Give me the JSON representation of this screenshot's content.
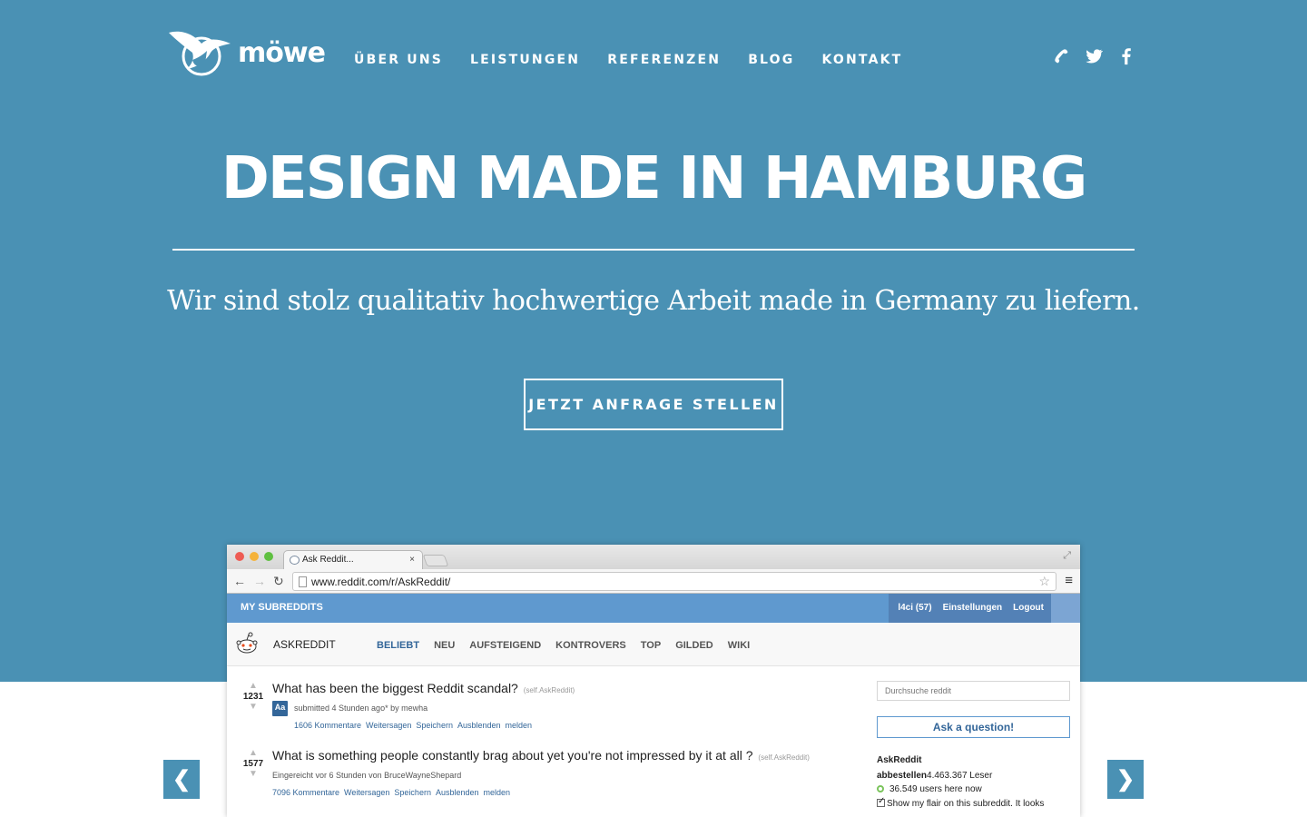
{
  "brand": {
    "name": "möwe",
    "logo_icon": "seagull-logo-icon"
  },
  "nav": {
    "items": [
      {
        "label": "ÜBER UNS"
      },
      {
        "label": "LEISTUNGEN"
      },
      {
        "label": "REFERENZEN"
      },
      {
        "label": "BLOG"
      },
      {
        "label": "KONTAKT"
      }
    ]
  },
  "social": {
    "icons": [
      "phone-icon",
      "twitter-icon",
      "facebook-icon"
    ]
  },
  "hero": {
    "headline": "DESIGN MADE IN HAMBURG",
    "subline": "Wir sind stolz qualitativ hochwertige Arbeit made in Germany zu liefern.",
    "cta": "JETZT ANFRAGE STELLEN"
  },
  "colors": {
    "hero_bg": "#4a91b4",
    "accent": "#ffffff"
  },
  "browser": {
    "tab_title": "Ask Reddit...",
    "tab_close": "×",
    "url": "www.reddit.com/r/AskReddit/",
    "reddit": {
      "my_subreddits": "MY SUBREDDITS",
      "user_links": [
        "l4ci (57)",
        "Einstellungen",
        "Logout"
      ],
      "subreddit_name": "ASKREDDIT",
      "tabs": [
        "BELIEBT",
        "NEU",
        "AUFSTEIGEND",
        "KONTROVERS",
        "TOP",
        "GILDED",
        "WIKI"
      ],
      "posts": [
        {
          "score": "1231",
          "title": "What has been the biggest Reddit scandal?",
          "domain": "(self.AskReddit)",
          "thumb": "Aa",
          "meta": "submitted 4 Stunden ago* by mewha",
          "links": [
            "1606 Kommentare",
            "Weitersagen",
            "Speichern",
            "Ausblenden",
            "melden"
          ]
        },
        {
          "score": "1577",
          "title": "What is something people constantly brag about yet you're not impressed by it at all ?",
          "domain": "(self.AskReddit)",
          "meta": "Eingereicht vor 6 Stunden von BruceWayneShepard",
          "links": [
            "7096 Kommentare",
            "Weitersagen",
            "Speichern",
            "Ausblenden",
            "melden"
          ]
        }
      ],
      "sidebar": {
        "search_placeholder": "Durchsuche reddit",
        "ask_button": "Ask a question!",
        "title": "AskReddit",
        "subscribe": "abbestellen",
        "readers": "4.463.367 Leser",
        "online": "36.549 users here now",
        "flair": "Show my flair on this subreddit. It looks"
      }
    }
  },
  "slider": {
    "prev": "❮",
    "next": "❯"
  }
}
